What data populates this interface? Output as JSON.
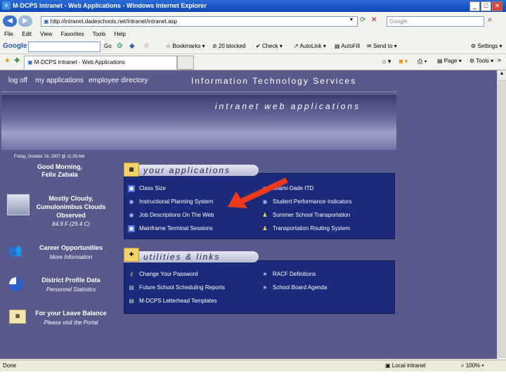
{
  "window": {
    "title": "M-DCPS Intranet - Web Applications - Windows Internet Explorer",
    "url": "http://intranet.dadeschools.net/intranet/intranet.asp",
    "search_placeholder": "Google",
    "menu": [
      "File",
      "Edit",
      "View",
      "Favorites",
      "Tools",
      "Help"
    ],
    "google_toolbar": {
      "brand": "Google",
      "go_label": "Go",
      "bookmarks": "Bookmarks",
      "blocked": "20 blocked",
      "check": "Check",
      "autolink": "AutoLink",
      "autofill": "AutoFill",
      "sendto": "Send to",
      "settings": "Settings"
    },
    "tab_title": "M-DCPS Intranet - Web Applications",
    "page_menu": "Page",
    "tools_menu": "Tools"
  },
  "nav": {
    "logoff": "log off",
    "myapps": "my applications",
    "directory": "employee directory",
    "its_title": "Information Technology Services",
    "banner_subtitle": "intranet web applications"
  },
  "sidebar": {
    "datetime": "Friday, October 19, 2007 @ 11:29 AM",
    "greeting": "Good Morning,",
    "user": "Felix Zabala",
    "weather": "Mostly Cloudy, Cumulonimbus Clouds Observed",
    "temp": "84.9 F (29.4 C)",
    "career_title": "Career Opportunities",
    "career_sub": "More Information",
    "district_title": "District Profile Data",
    "district_sub": "Personnel Statistics",
    "leave_title": "For your Leave Balance",
    "leave_sub": "Please visit the Portal"
  },
  "apps": {
    "heading": "your applications",
    "left": [
      "Class Size",
      "Instructional Planning System",
      "Job Descriptions On The Web",
      "Mainframe Terminal Sessions"
    ],
    "right": [
      "Miami-Dade ITD",
      "Student Performance Indicators",
      "Summer School Transportation",
      "Transportation Routing System"
    ]
  },
  "utils": {
    "heading": "utilities & links",
    "left": [
      "Change Your Password",
      "Future School Scheduling Reports",
      "M-DCPS Letterhead Templates"
    ],
    "right": [
      "RACF Definitions",
      "School Board Agenda"
    ]
  },
  "status": {
    "left": "Done",
    "zone": "Local intranet",
    "zoom": "100%"
  },
  "colors": {
    "page_bg": "#595a8c",
    "panel_bg": "#1b2a7a",
    "arrow": "#ee3a1a"
  }
}
